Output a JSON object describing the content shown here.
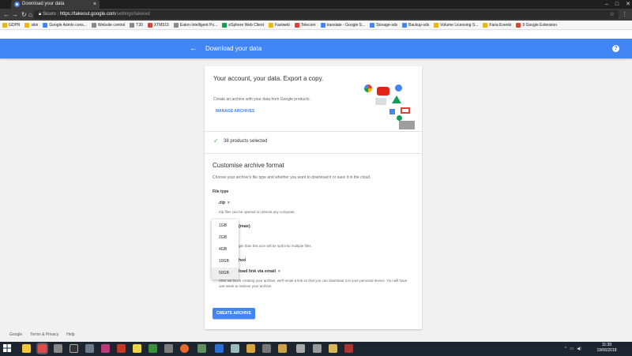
{
  "browser": {
    "tab_title": "Download your data",
    "tab_close": "×",
    "secure_label": "Sicuro",
    "url_host": "https://takeout.google.com",
    "url_path": "/settings/takeout",
    "bookmarks": [
      {
        "label": "GDPR",
        "color": "#f4b400"
      },
      {
        "label": "sitni",
        "color": "#f4b400"
      },
      {
        "label": "Google Admin cons...",
        "color": "#4285f4"
      },
      {
        "label": "Website control",
        "color": "#888888"
      },
      {
        "label": "T30",
        "color": "#888888"
      },
      {
        "label": "XTM515",
        "color": "#db4437"
      },
      {
        "label": "Eaton Intelligent Po...",
        "color": "#888888"
      },
      {
        "label": "eSphere Web Client",
        "color": "#0f9d58"
      },
      {
        "label": "Fastweb",
        "color": "#f4b400"
      },
      {
        "label": "Telecom",
        "color": "#db4437"
      },
      {
        "label": "translate - Google S...",
        "color": "#4285f4"
      },
      {
        "label": "Storage-sds",
        "color": "#4285f4"
      },
      {
        "label": "Backup-sds",
        "color": "#4285f4"
      },
      {
        "label": "Volume Licensing S...",
        "color": "#f4b400"
      },
      {
        "label": "Faria Events",
        "color": "#f4b400"
      },
      {
        "label": "5 Google Extension",
        "color": "#db4437"
      }
    ]
  },
  "header": {
    "title": "Download your data",
    "back_icon": "arrow-left-icon",
    "help_icon": "help-icon",
    "help_glyph": "?"
  },
  "intro": {
    "title": "Your account, your data. Export a copy.",
    "description": "Create an archive with your data from Google products.",
    "manage_archives": "MANAGE ARCHIVES"
  },
  "products": {
    "selected_text": "38 products selected"
  },
  "customise": {
    "title": "Customise archive format",
    "description": "Choose your archive's file type and whether you want to download it or save it in the cloud.",
    "file_type_label": "File type",
    "file_type_value": ".zip",
    "file_type_hint": "Zip files can be opened on almost any computer.",
    "archive_size_value": "(max)",
    "archive_size_hint": "ger than this size will be split into multiple files.",
    "delivery_label": "hod",
    "delivery_value": "load link via email",
    "delivery_desc": "After we finish creating your archive, we'll email a link so that you can download it to your personal device. You will have one week to retrieve your archive.",
    "size_options": [
      "1GB",
      "2GB",
      "4GB",
      "10GB",
      "50GB"
    ],
    "selected_option": "50GB"
  },
  "create_button": "CREATE ARCHIVE",
  "footer": {
    "links": [
      "Google",
      "Terms & Privacy",
      "Help"
    ]
  },
  "taskbar": {
    "time": "11:39",
    "date": "19/06/2018"
  },
  "colors": {
    "brand_blue": "#4285f4",
    "success_green": "#4caf50"
  }
}
